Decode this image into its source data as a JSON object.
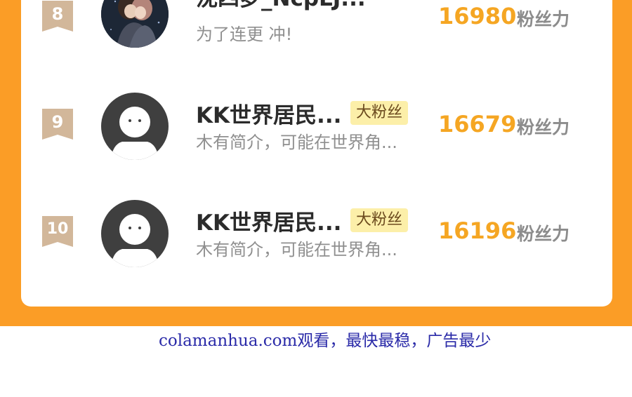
{
  "ranking": {
    "rows": [
      {
        "rank": "8",
        "name": "沈四梦_NcpLJ...",
        "tag": "",
        "bio": "为了连更 冲!",
        "score": "16980",
        "score_unit": "粉丝力",
        "avatar": "illustrated-couple-avatar"
      },
      {
        "rank": "9",
        "name": "KK世界居民...",
        "tag": "大粉丝",
        "bio": "木有简介，可能在世界角...",
        "score": "16679",
        "score_unit": "粉丝力",
        "avatar": "default-user-avatar"
      },
      {
        "rank": "10",
        "name": "KK世界居民...",
        "tag": "大粉丝",
        "bio": "木有简介，可能在世界角...",
        "score": "16196",
        "score_unit": "粉丝力",
        "avatar": "default-user-avatar"
      }
    ]
  },
  "footer": {
    "watermark": "colamanhua.com观看，最快最稳，广告最少"
  },
  "colors": {
    "frame_orange": "#fb9d26",
    "score_gold": "#f5a623",
    "badge_tan": "#d2b79a",
    "tag_yellow": "#fcefa9",
    "watermark_blue": "#2a2aa8"
  }
}
